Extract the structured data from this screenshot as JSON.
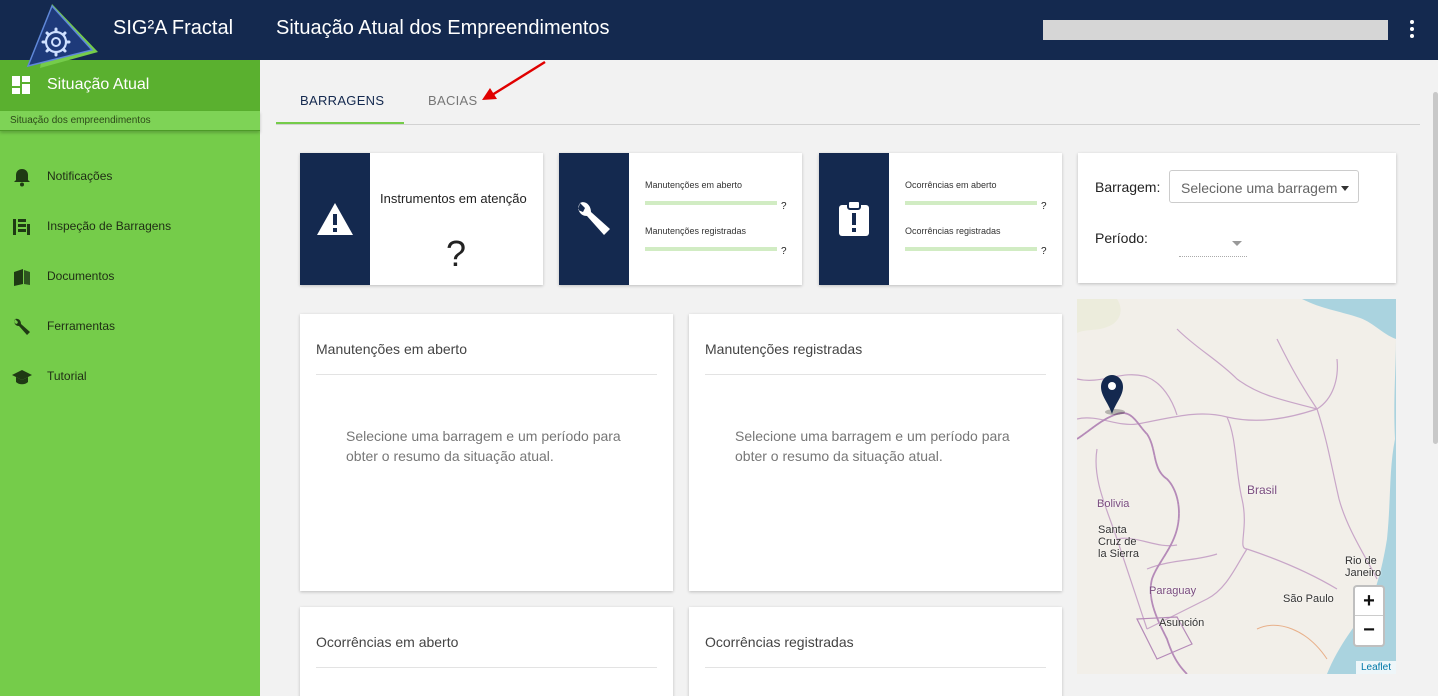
{
  "header": {
    "app_name": "SIG²A Fractal",
    "page_title": "Situação Atual dos Empreendimentos"
  },
  "sidebar": {
    "active": {
      "label": "Situação Atual",
      "subtitle": "Situação dos empreendimentos"
    },
    "items": [
      {
        "label": "Notificações",
        "icon": "bell-icon"
      },
      {
        "label": "Inspeção de Barragens",
        "icon": "inspection-icon"
      },
      {
        "label": "Documentos",
        "icon": "documents-icon"
      },
      {
        "label": "Ferramentas",
        "icon": "wrench-icon"
      },
      {
        "label": "Tutorial",
        "icon": "graduation-cap-icon"
      }
    ]
  },
  "tabs": [
    {
      "label": "BARRAGENS",
      "active": true
    },
    {
      "label": "BACIAS",
      "active": false
    }
  ],
  "stats": {
    "instrumentos": {
      "title": "Instrumentos em atenção",
      "value": "?"
    },
    "manutencoes": {
      "open_label": "Manutenções em aberto",
      "open_value": "?",
      "registered_label": "Manutenções registradas",
      "registered_value": "?"
    },
    "ocorrencias": {
      "open_label": "Ocorrências em aberto",
      "open_value": "?",
      "registered_label": "Ocorrências registradas",
      "registered_value": "?"
    }
  },
  "filter": {
    "barragem_label": "Barragem:",
    "barragem_placeholder": "Selecione uma barragem",
    "periodo_label": "Período:"
  },
  "panels": [
    {
      "title": "Manutenções em aberto",
      "message": "Selecione uma barragem e um período para obter o resumo da situação atual."
    },
    {
      "title": "Manutenções registradas",
      "message": "Selecione uma barragem e um período para obter o resumo da situação atual."
    },
    {
      "title": "Ocorrências em aberto"
    },
    {
      "title": "Ocorrências registradas"
    }
  ],
  "map": {
    "labels": {
      "bolivia": "Bolivia",
      "brasil": "Brasil",
      "santa_cruz": "Santa Cruz de la Sierra",
      "rio": "Rio de Janeiro",
      "paraguay": "Paraguay",
      "sao_paulo": "São Paulo",
      "asuncion": "Asunción"
    },
    "zoom_in": "+",
    "zoom_out": "−",
    "attribution": "Leaflet"
  },
  "colors": {
    "navy": "#14294f",
    "green": "#75cc4a",
    "green_dark": "#5ab02f"
  }
}
